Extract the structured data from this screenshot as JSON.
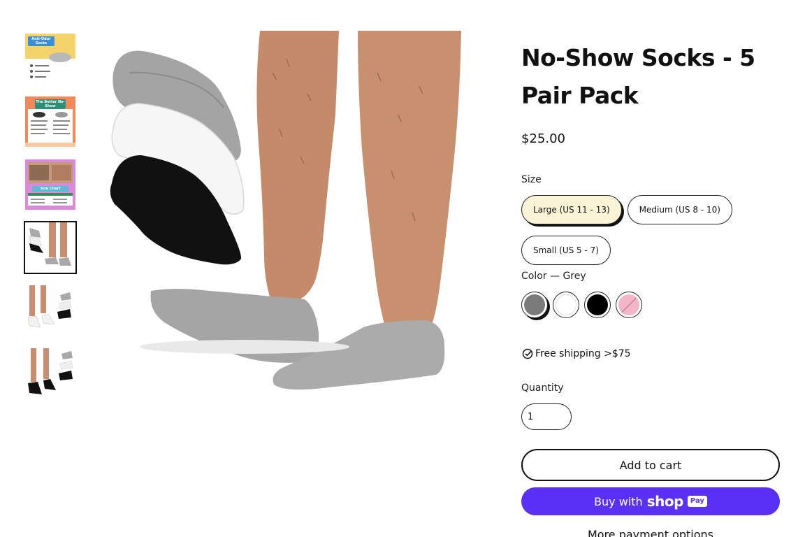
{
  "product": {
    "title": "No-Show Socks - 5 Pair Pack",
    "price": "$25.00"
  },
  "size": {
    "label": "Size",
    "options": [
      "Large (US 11 - 13)",
      "Medium (US 8 - 10)",
      "Small (US 5 - 7)"
    ],
    "selected": "Large (US 11 - 13)"
  },
  "color": {
    "label": "Color — Grey",
    "swatches": [
      {
        "name": "Grey",
        "hex": "#7a7a7a",
        "selected": true
      },
      {
        "name": "White",
        "hex": "#ffffff",
        "selected": false
      },
      {
        "name": "Black",
        "hex": "#000000",
        "selected": false
      },
      {
        "name": "Pink",
        "hex": "#f3b6c8",
        "selected": false,
        "unavailable": true
      }
    ]
  },
  "shipping": {
    "text": "Free shipping >$75",
    "icon": "check-circle-icon"
  },
  "quantity": {
    "label": "Quantity",
    "value": "1"
  },
  "buttons": {
    "add_to_cart": "Add to cart",
    "buy_with": "Buy with",
    "shop_word": "shop",
    "pay_word": "Pay",
    "more_payment": "More payment options"
  },
  "thumbnails": {
    "t1_title": "Anti-Odor Socks",
    "t2_title": "The Better No-Show",
    "t3_title": "Size Chart"
  },
  "colors": {
    "shop_pay": "#5a31f4",
    "selected_pill": "#fbf3d5"
  }
}
